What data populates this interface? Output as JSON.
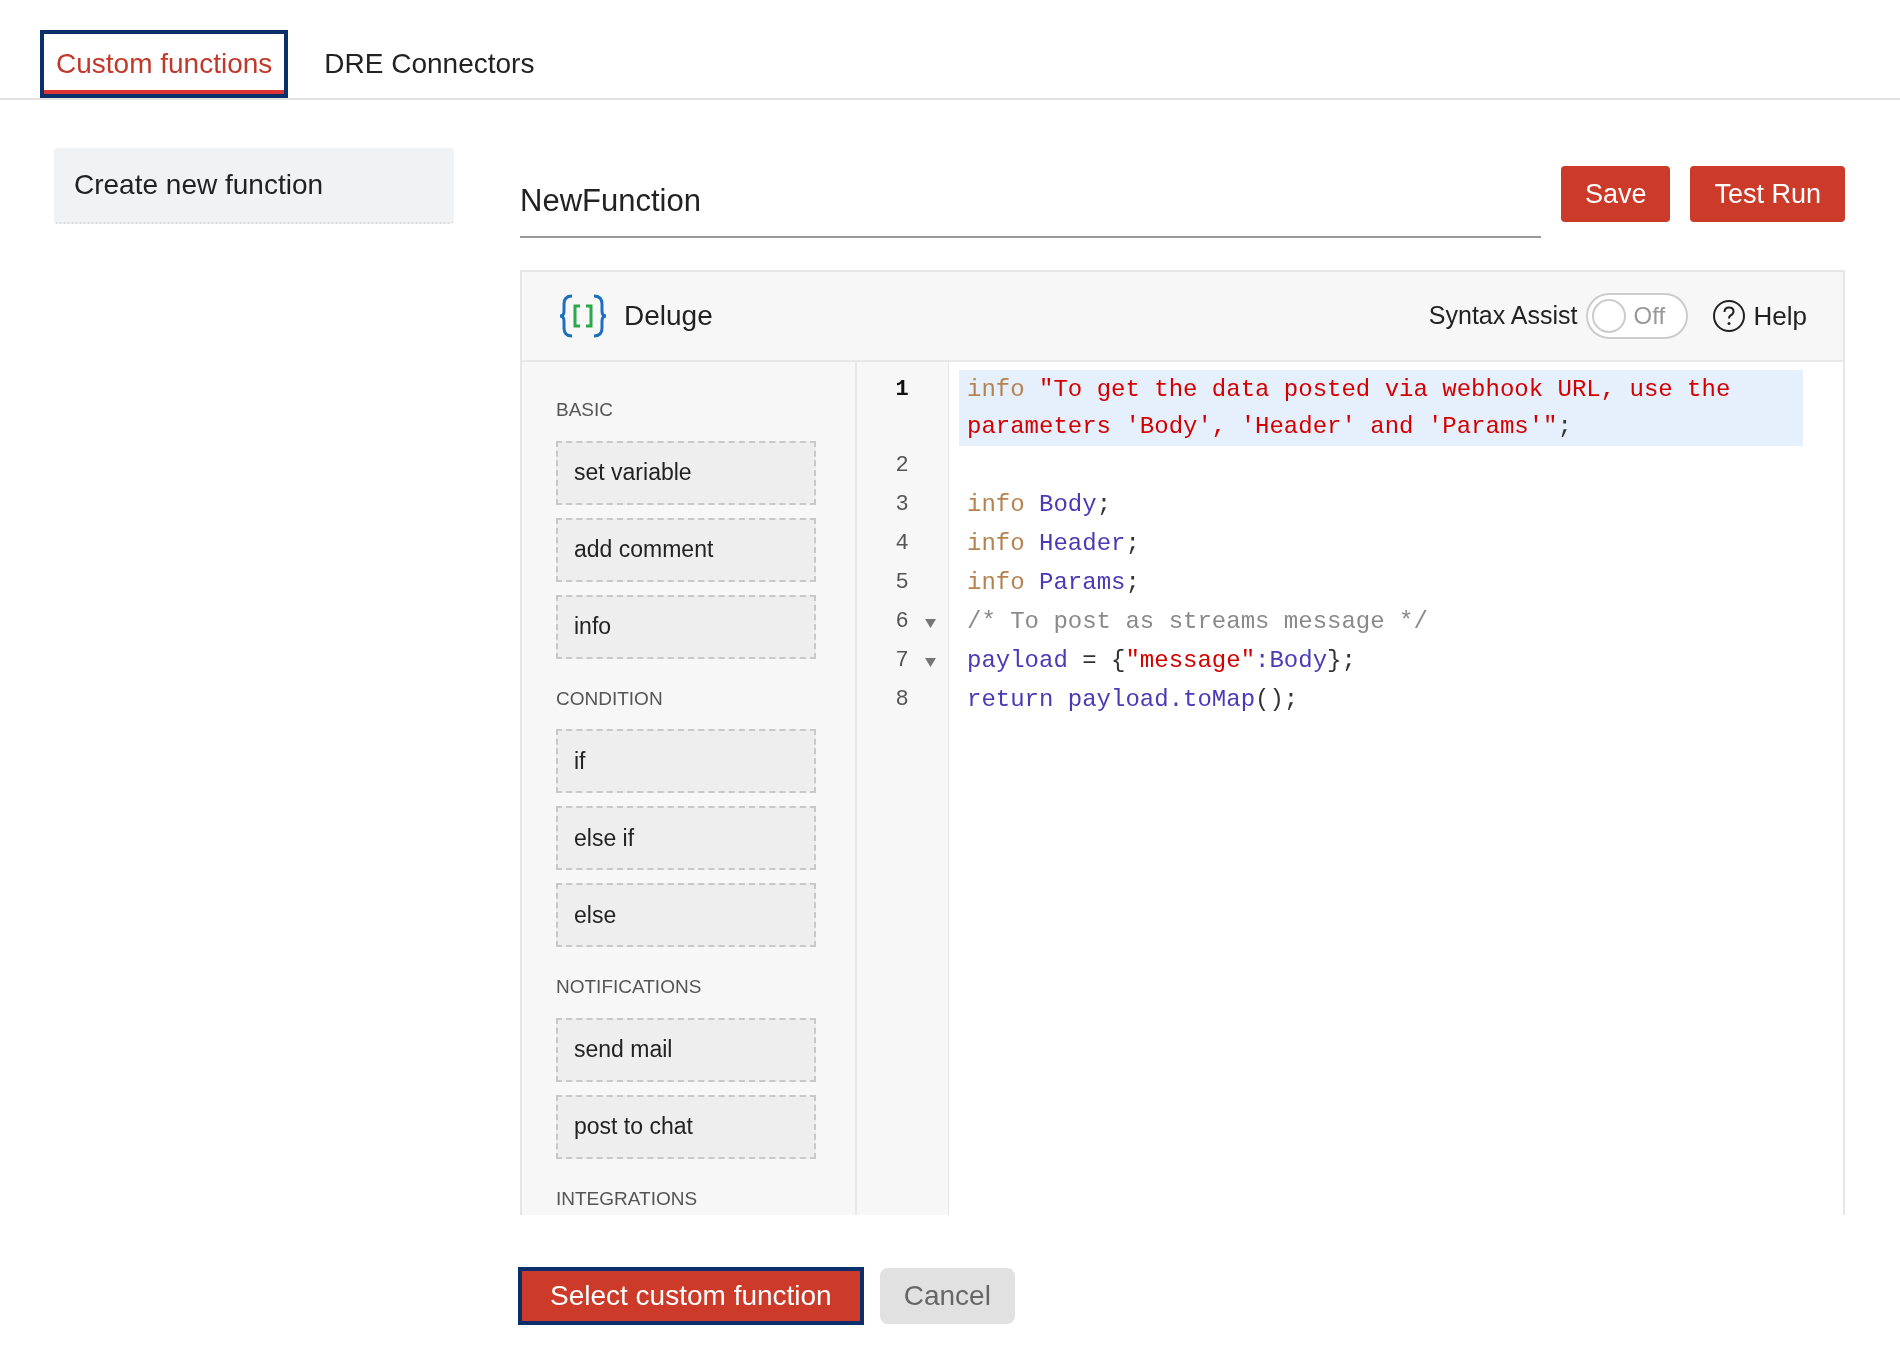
{
  "tabs": [
    {
      "label": "Custom functions",
      "selected": true
    },
    {
      "label": "DRE Connectors",
      "selected": false
    }
  ],
  "sidebar": {
    "create_button": "Create new function"
  },
  "function_name": {
    "value": "NewFunction"
  },
  "actions": [
    "Save",
    "Test Run"
  ],
  "editor": {
    "language": "Deluge",
    "syntax_assist": {
      "label": "Syntax Assist",
      "on": false,
      "state_text": "Off"
    },
    "help": "Help",
    "palette": [
      {
        "heading": "BASIC",
        "items": [
          "set variable",
          "add comment",
          "info"
        ]
      },
      {
        "heading": "CONDITION",
        "items": [
          "if",
          "else if",
          "else"
        ]
      },
      {
        "heading": "NOTIFICATIONS",
        "items": [
          "send mail",
          "post to chat"
        ]
      },
      {
        "heading": "INTEGRATIONS"
      }
    ],
    "lines": [
      {
        "number": "1",
        "selected": true,
        "foldable": false,
        "tokens": [
          {
            "kind": "keyword",
            "text": "info "
          },
          {
            "kind": "string",
            "text": "\"To get the data posted via webhook URL, use the parameters 'Body', 'Header' and 'Params'\""
          },
          {
            "kind": "punct",
            "text": ";"
          }
        ]
      },
      {
        "number": "2",
        "selected": false,
        "foldable": false
      },
      {
        "number": "3",
        "selected": false,
        "foldable": false,
        "tokens": [
          {
            "kind": "keyword",
            "text": "info "
          },
          {
            "kind": "variable",
            "text": "Body"
          },
          {
            "kind": "punct",
            "text": ";"
          }
        ]
      },
      {
        "number": "4",
        "selected": false,
        "foldable": false,
        "tokens": [
          {
            "kind": "keyword",
            "text": "info "
          },
          {
            "kind": "variable",
            "text": "Header"
          },
          {
            "kind": "punct",
            "text": ";"
          }
        ]
      },
      {
        "number": "5",
        "selected": false,
        "foldable": false,
        "tokens": [
          {
            "kind": "keyword",
            "text": "info "
          },
          {
            "kind": "variable",
            "text": "Params"
          },
          {
            "kind": "punct",
            "text": ";"
          }
        ]
      },
      {
        "number": "6",
        "selected": false,
        "foldable": true,
        "tokens": [
          {
            "kind": "comment",
            "text": "/* To post as streams message */"
          }
        ]
      },
      {
        "number": "7",
        "selected": false,
        "foldable": true,
        "tokens": [
          {
            "kind": "variable",
            "text": "payload "
          },
          {
            "kind": "punct",
            "text": "= {"
          },
          {
            "kind": "string",
            "text": "\"message\""
          },
          {
            "kind": "variable",
            "text": ":Body"
          },
          {
            "kind": "punct",
            "text": "};"
          }
        ]
      },
      {
        "number": "8",
        "selected": false,
        "foldable": false,
        "tokens": [
          {
            "kind": "variable",
            "text": "return payload.toMap"
          },
          {
            "kind": "punct",
            "text": "();"
          }
        ]
      }
    ]
  },
  "footer_buttons": [
    {
      "label": "Select custom function",
      "kind": "primary"
    },
    {
      "label": "Cancel",
      "kind": "secondary"
    }
  ]
}
